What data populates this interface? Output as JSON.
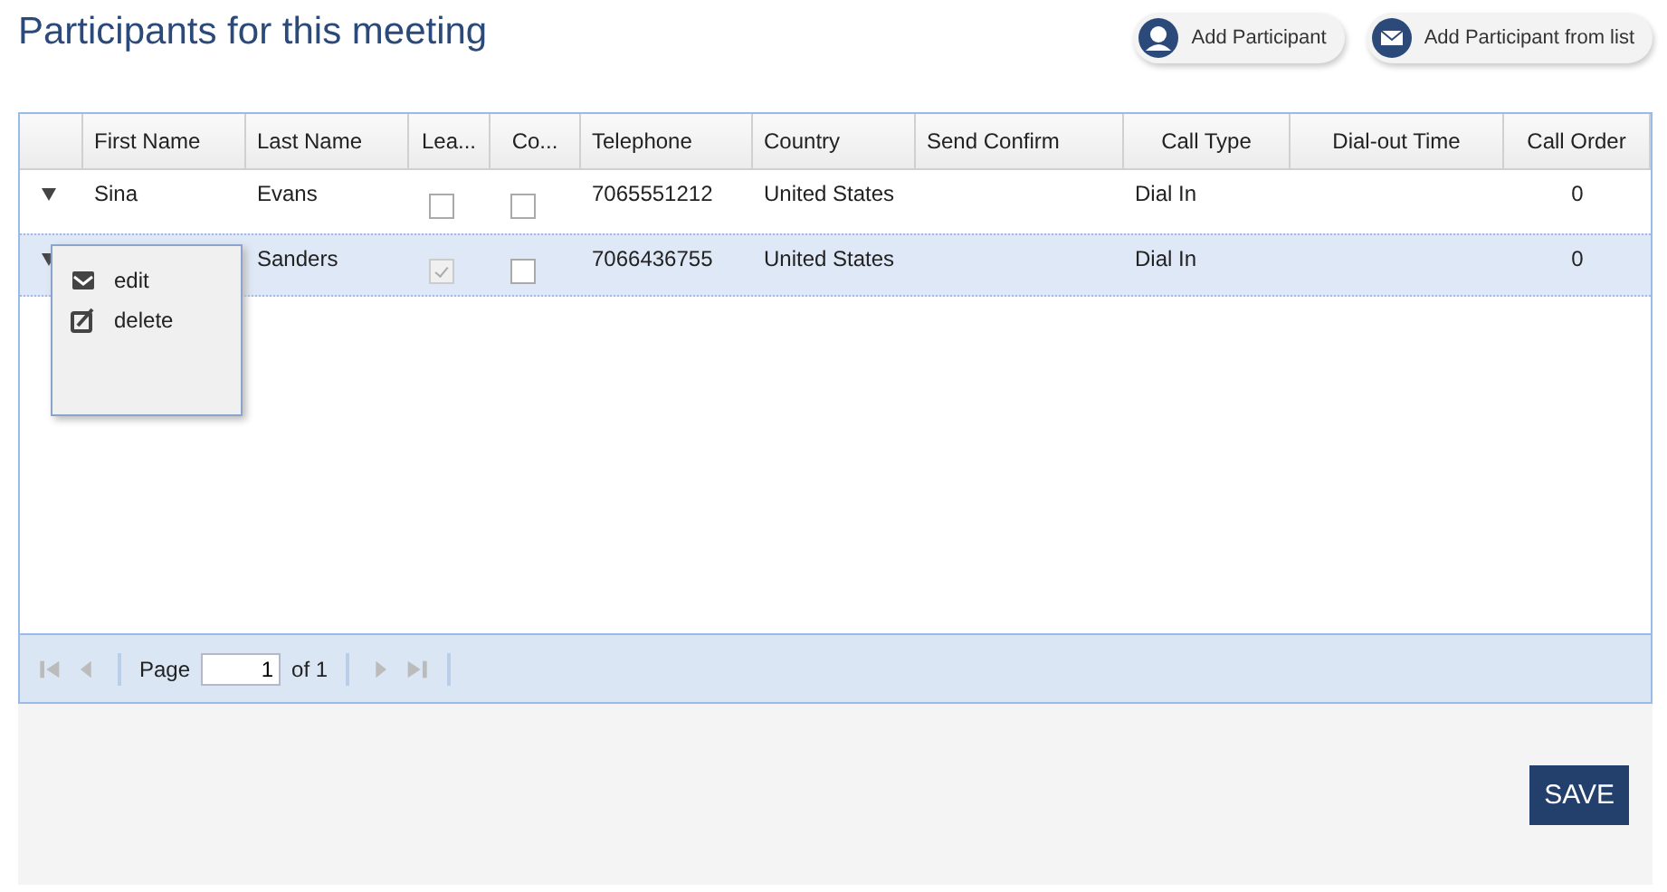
{
  "title": "Participants for this meeting",
  "actions": [
    {
      "label": "Add Participant",
      "kind": "person"
    },
    {
      "label": "Add Participant from list",
      "kind": "list"
    }
  ],
  "table": {
    "columns": [
      "First Name",
      "Last Name",
      "Lea...",
      "Co...",
      "Telephone",
      "Country",
      "Send Confirm",
      "Call Type",
      "Dial-out Time",
      "Call Order"
    ],
    "rows": [
      {
        "first_name": "Sina",
        "last_name": "Evans",
        "leader": false,
        "confirm": false,
        "telephone": "7065551212",
        "country": "United States",
        "call_type": "Dial In",
        "call_order": "0",
        "selected": false
      },
      {
        "first_name": "",
        "last_name": "Sanders",
        "leader": true,
        "confirm": false,
        "telephone": "7066436755",
        "country": "United States",
        "call_type": "Dial In",
        "call_order": "0",
        "selected": true
      }
    ]
  },
  "context_menu": [
    {
      "label": "edit",
      "kind": "edit"
    },
    {
      "label": "delete",
      "kind": "delete"
    }
  ],
  "pager": {
    "label": "Page",
    "value": "1",
    "total": "of 1"
  },
  "save_button": "SAVE"
}
